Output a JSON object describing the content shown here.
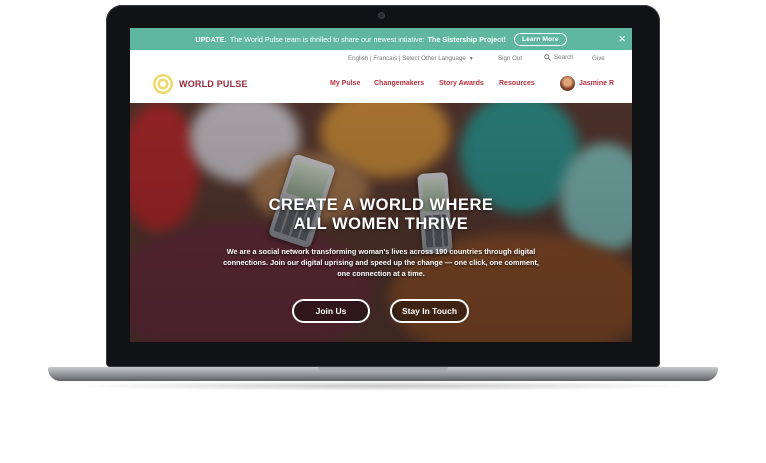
{
  "banner": {
    "label": "UPDATE:",
    "message": "The World Pulse team is thrilled to share our newest intiative:",
    "project": "The Sistership Project!",
    "button": "Learn More",
    "close_icon": "×"
  },
  "utility": {
    "language": "English | Francais | Select Other Language",
    "sign_out": "Sign Out",
    "search": "Search",
    "give": "Give"
  },
  "nav": {
    "logo_text": "WORLD PULSE",
    "items": [
      "My Pulse",
      "Changemakers",
      "Story Awards",
      "Resources"
    ],
    "user": "Jasmine R"
  },
  "hero": {
    "title_line1": "CREATE A WORLD WHERE",
    "title_line2": "ALL WOMEN THRIVE",
    "subtitle": "We are a social network transforming woman's lives across 190 countries through digital connections. Join our digital uprising and speed up the change — one click, one comment, one connection at a time.",
    "join_button": "Join Us",
    "contact_button": "Stay In Touch"
  },
  "colors": {
    "banner": "#5fb89e",
    "brand": "#b9303f"
  },
  "icons": {
    "search": "magnifier-icon",
    "close": "close-icon",
    "caret": "chevron-down-icon"
  }
}
